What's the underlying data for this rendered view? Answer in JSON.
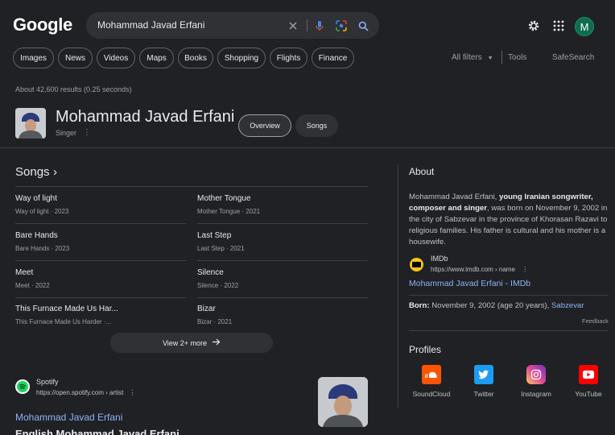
{
  "header": {
    "logo": "Google",
    "search_value": "Mohammad Javad Erfani",
    "avatar_initial": "M"
  },
  "chips": [
    "Images",
    "News",
    "Videos",
    "Maps",
    "Books",
    "Shopping",
    "Flights",
    "Finance"
  ],
  "tools": {
    "all_filters": "All filters",
    "tools": "Tools",
    "safesearch": "SafeSearch"
  },
  "results_count": "About 42,600 results (0.25 seconds)",
  "entity": {
    "title": "Mohammad Javad Erfani",
    "subtitle": "Singer",
    "tabs": [
      "Overview",
      "Songs"
    ]
  },
  "songs": {
    "heading": "Songs",
    "items": [
      {
        "title": "Way of light",
        "sub": "Way of light · 2023"
      },
      {
        "title": "Mother Tongue",
        "sub": "Mother Tongue · 2021"
      },
      {
        "title": "Bare Hands",
        "sub": "Bare Hands · 2023"
      },
      {
        "title": "Last Step",
        "sub": "Last Step · 2021"
      },
      {
        "title": "Meet",
        "sub": "Meet · 2022"
      },
      {
        "title": "Silence",
        "sub": "Silence · 2022"
      },
      {
        "title": "This Furnace Made Us Har...",
        "sub": "This Furnace Made Us Harder ·..."
      },
      {
        "title": "Bizar",
        "sub": "Bizar · 2021"
      }
    ],
    "view_more": "View 2+ more"
  },
  "spotify": {
    "name": "Spotify",
    "url": "https://open.spotify.com › artist",
    "link": "Mohammad Javad Erfani",
    "snippet": "English Mohammad Javad Erfani"
  },
  "about": {
    "heading": "About",
    "text_1": "Mohammad Javad Erfani, ",
    "text_bold": "young Iranian songwriter, composer and singer",
    "text_2": ", was born on November 9, 2002 in the city of Sabzevar in the province of Khorasan Razavi to religious families. His father is cultural and his mother is a housewife.",
    "source_name": "IMDb",
    "source_url": "https://www.imdb.com › name",
    "source_link": "Mohammad Javad Erfani - IMDb",
    "born_label": "Born:",
    "born_value": " November 9, 2002 (age 20 years), ",
    "born_place": "Sabzevar",
    "feedback": "Feedback"
  },
  "profiles": {
    "heading": "Profiles",
    "items": [
      {
        "label": "SoundCloud",
        "color": "#ff5500"
      },
      {
        "label": "Twitter",
        "color": "#1d9bf0"
      },
      {
        "label": "Instagram",
        "color": "#d6249f"
      },
      {
        "label": "YouTube",
        "color": "#ff0000"
      }
    ]
  }
}
